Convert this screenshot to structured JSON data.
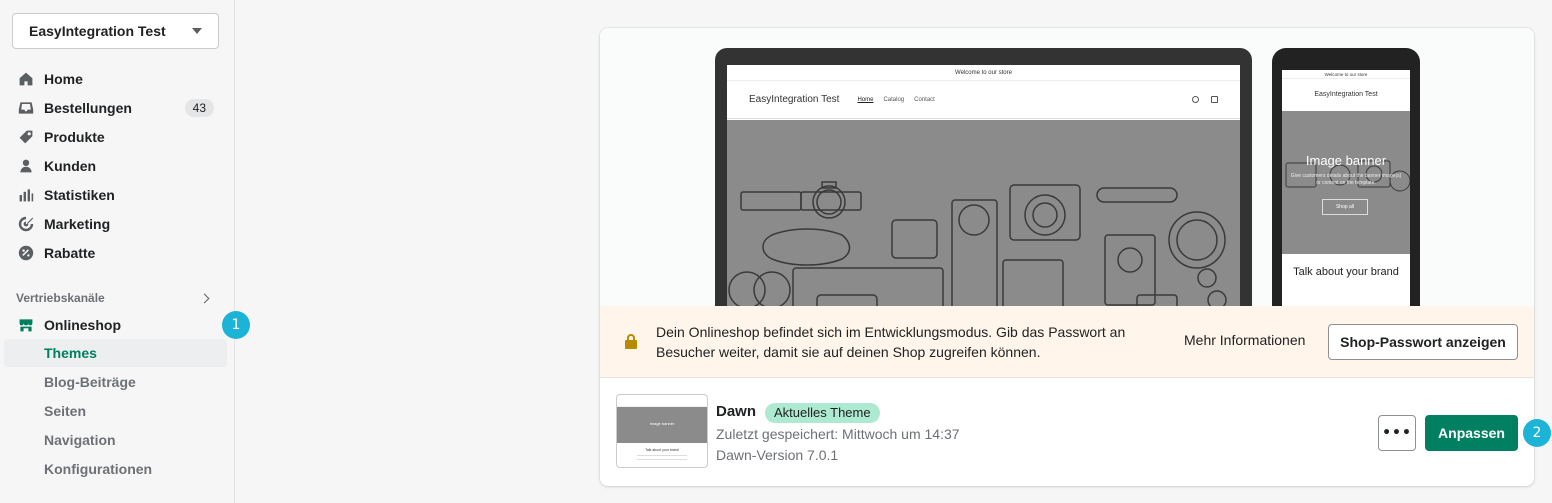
{
  "sidebar": {
    "store_name": "EasyIntegration Test",
    "items": [
      {
        "label": "Home",
        "icon": "home-icon"
      },
      {
        "label": "Bestellungen",
        "icon": "inbox-icon",
        "badge": "43"
      },
      {
        "label": "Produkte",
        "icon": "tag-icon"
      },
      {
        "label": "Kunden",
        "icon": "person-icon"
      },
      {
        "label": "Statistiken",
        "icon": "bar-chart-icon"
      },
      {
        "label": "Marketing",
        "icon": "target-icon"
      },
      {
        "label": "Rabatte",
        "icon": "discount-icon"
      }
    ],
    "channels_header": "Vertriebskanäle",
    "online_store": "Onlineshop",
    "sub_items": [
      "Themes",
      "Blog-Beiträge",
      "Seiten",
      "Navigation",
      "Konfigurationen"
    ],
    "active_sub": "Themes"
  },
  "steps": {
    "one": "1",
    "two": "2"
  },
  "preview": {
    "desktop": {
      "announcement": "Welcome to our store",
      "brand": "EasyIntegration Test",
      "nav": [
        "Home",
        "Catalog",
        "Contact"
      ]
    },
    "mobile": {
      "announcement": "Welcome to our store",
      "brand": "EasyIntegration Test",
      "banner_title": "Image banner",
      "banner_text": "Give customers details about the banner image(s) or content on the template.",
      "banner_button": "Shop all",
      "talk": "Talk about your brand"
    }
  },
  "notice": {
    "text": "Dein Onlineshop befindet sich im Entwicklungsmodus. Gib das Passwort an Besucher weiter, damit sie auf deinen Shop zugreifen können.",
    "more_info": "Mehr Informationen",
    "password_button": "Shop-Passwort anzeigen"
  },
  "theme": {
    "name": "Dawn",
    "badge": "Aktuelles Theme",
    "saved": "Zuletzt gespeichert: Mittwoch um 14:37",
    "version": "Dawn-Version 7.0.1",
    "more_label": "•••",
    "customize_button": "Anpassen",
    "thumb_banner": "Image banner",
    "thumb_welcome": "Talk about your brand"
  },
  "colors": {
    "primary": "#008060",
    "active_green": "#007f5f",
    "step_badge": "#1cb4d6",
    "notice_bg": "#fff5ea",
    "badge_bg": "#aee9d1"
  }
}
